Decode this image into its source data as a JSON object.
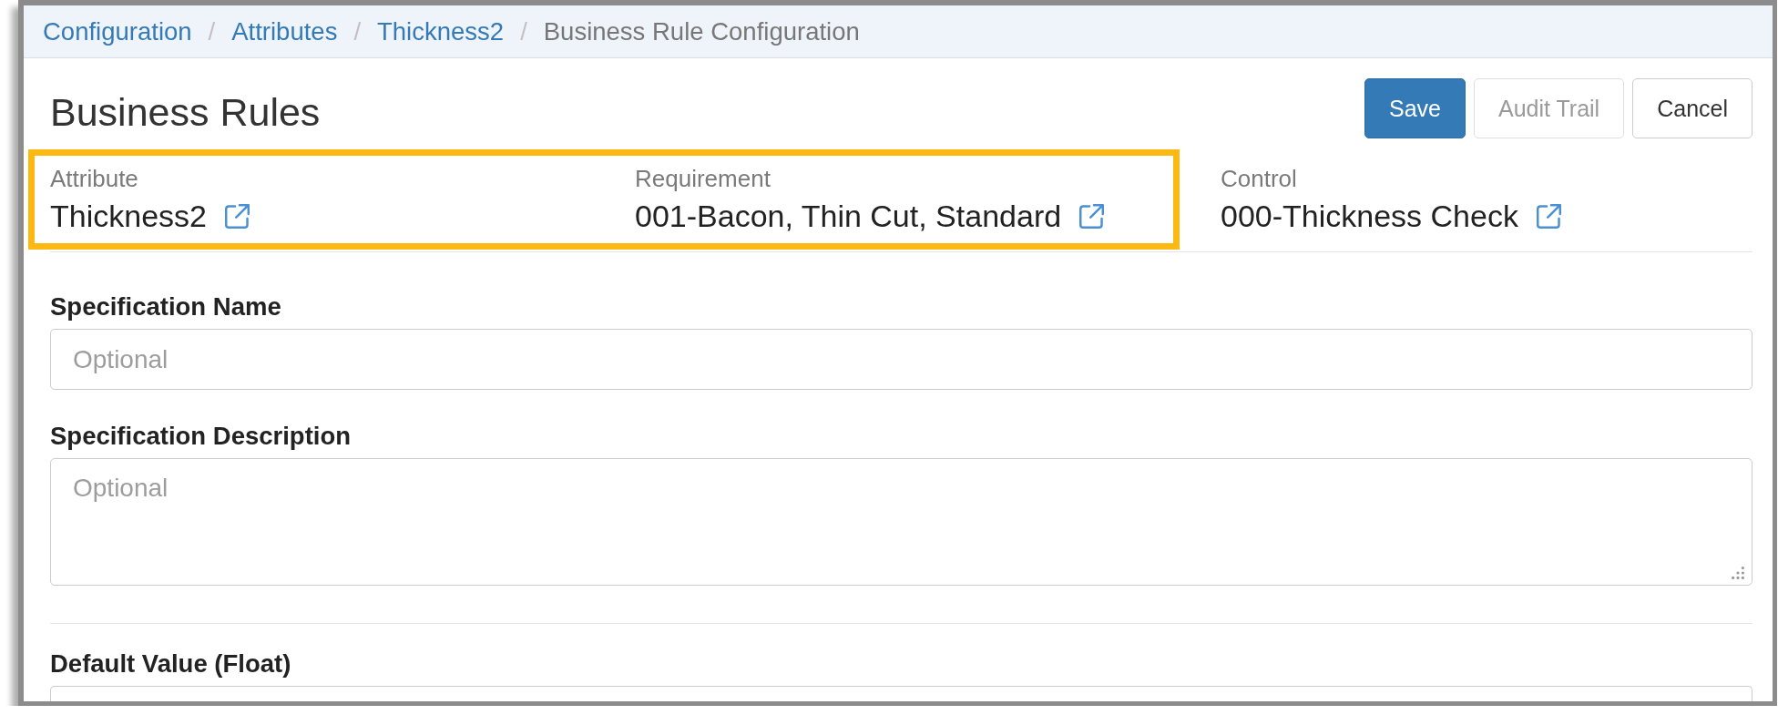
{
  "breadcrumb": [
    {
      "label": "Configuration",
      "kind": "link"
    },
    {
      "separator": "/",
      "label": "Attributes",
      "kind": "link"
    },
    {
      "separator": "/",
      "label": "Thickness2",
      "kind": "link"
    },
    {
      "separator": "/",
      "label": "Business Rule Configuration",
      "kind": "current"
    }
  ],
  "page": {
    "title": "Business Rules"
  },
  "actions": [
    {
      "label": "Save",
      "kind": "primary",
      "disabled": false
    },
    {
      "label": "Audit Trail",
      "kind": "default",
      "disabled": true
    },
    {
      "label": "Cancel",
      "kind": "default",
      "disabled": false
    }
  ],
  "summary": [
    {
      "label": "Attribute",
      "value": "Thickness2",
      "highlighted": true
    },
    {
      "label": "Requirement",
      "value": "001-Bacon, Thin Cut, Standard",
      "highlighted": true
    },
    {
      "label": "Control",
      "value": "000-Thickness Check",
      "highlighted": false
    }
  ],
  "form": {
    "sections": [
      {
        "fields": [
          {
            "kind": "input",
            "label": "Specification Name",
            "placeholder": "Optional"
          },
          {
            "kind": "textarea",
            "label": "Specification Description",
            "placeholder": "Optional"
          }
        ]
      },
      {
        "fields": [
          {
            "kind": "input",
            "label": "Default Value (Float)"
          }
        ]
      }
    ]
  }
}
